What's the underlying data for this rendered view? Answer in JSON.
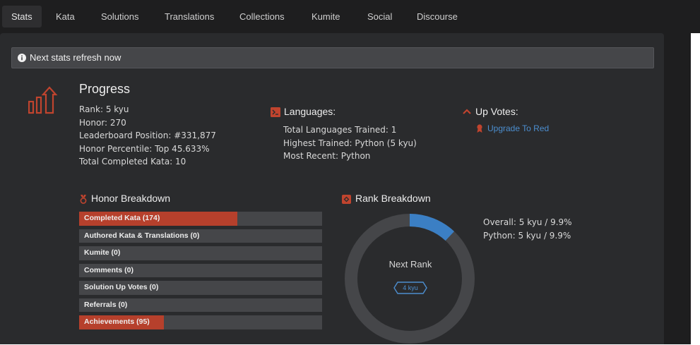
{
  "tabs": [
    {
      "label": "Stats",
      "active": true
    },
    {
      "label": "Kata"
    },
    {
      "label": "Solutions"
    },
    {
      "label": "Translations"
    },
    {
      "label": "Collections"
    },
    {
      "label": "Kumite"
    },
    {
      "label": "Social"
    },
    {
      "label": "Discourse"
    }
  ],
  "alert": {
    "icon": "info-icon",
    "text": "Next stats refresh now"
  },
  "progress": {
    "icon": "progress-arrow-icon",
    "title": "Progress",
    "lines": [
      "Rank: 5 kyu",
      "Honor: 270",
      "Leaderboard Position: #331,877",
      "Honor Percentile: Top 45.633%",
      "Total Completed Kata: 10"
    ]
  },
  "languages": {
    "icon": "terminal-icon",
    "title": "Languages:",
    "lines": [
      "Total Languages Trained: 1",
      "Highest Trained: Python (5 kyu)",
      "Most Recent: Python"
    ]
  },
  "upvotes": {
    "icon": "chevron-up-icon",
    "title": "Up Votes:",
    "link_icon": "ribbon-icon",
    "link": "Upgrade To Red"
  },
  "honor_breakdown": {
    "icon": "medal-icon",
    "title": "Honor Breakdown",
    "items": [
      {
        "label": "Completed Kata (174)",
        "fill": 0.65
      },
      {
        "label": "Authored Kata & Translations (0)",
        "fill": 0
      },
      {
        "label": "Kumite (0)",
        "fill": 0
      },
      {
        "label": "Comments (0)",
        "fill": 0
      },
      {
        "label": "Solution Up Votes (0)",
        "fill": 0
      },
      {
        "label": "Referrals (0)",
        "fill": 0
      },
      {
        "label": "Achievements (95)",
        "fill": 0.35
      }
    ]
  },
  "rank_breakdown": {
    "icon": "rank-badge-icon",
    "title": "Rank Breakdown",
    "center_label": "Next Rank",
    "next_rank": "4 kyu",
    "progress": 0.12,
    "lines": [
      "Overall: 5 kyu / 9.9%",
      "Python: 5 kyu / 9.9%"
    ]
  },
  "colors": {
    "background": "#1e1e1f",
    "panel": "#2a2b2d",
    "accent_red": "#b6402c",
    "accent_blue": "#4c8ecf",
    "bar_bg": "#454649"
  }
}
